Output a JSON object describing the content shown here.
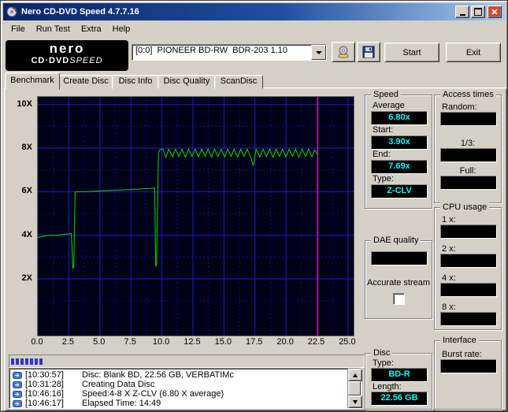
{
  "window": {
    "title": "Nero CD-DVD Speed 4.7.7.16"
  },
  "menu": {
    "items": [
      {
        "label": "File"
      },
      {
        "label": "Run Test"
      },
      {
        "label": "Extra"
      },
      {
        "label": "Help"
      }
    ]
  },
  "toolbar": {
    "logo": {
      "brand": "nero",
      "product_left": "CD·DVD",
      "product_right": "SPEED"
    },
    "drive_select": {
      "value": "[0:0]  PIONEER BD-RW  BDR-203 1.10"
    },
    "start_label": "Start",
    "exit_label": "Exit"
  },
  "tabs": {
    "items": [
      {
        "label": "Benchmark"
      },
      {
        "label": "Create Disc"
      },
      {
        "label": "Disc Info"
      },
      {
        "label": "Disc Quality"
      },
      {
        "label": "ScanDisc"
      }
    ],
    "active_index": 0
  },
  "chart_data": {
    "type": "line",
    "title": "",
    "xlabel": "",
    "ylabel": "",
    "x_ticks": [
      0,
      2.5,
      5,
      7.5,
      10,
      12.5,
      15,
      17.5,
      20,
      22.5,
      25
    ],
    "x_tick_labels": [
      "0.0",
      "2.5",
      "5.0",
      "7.5",
      "10.0",
      "12.5",
      "15.0",
      "17.5",
      "20.0",
      "22.5",
      "25.0"
    ],
    "y_ticks": [
      2,
      4,
      6,
      8,
      10
    ],
    "y_tick_labels": [
      "2X",
      "4X",
      "6X",
      "8X",
      "10X"
    ],
    "y_minor_ticks": [
      1,
      3,
      5,
      7,
      9
    ],
    "x_minor_step": 1.25,
    "xlim": [
      0,
      25.45
    ],
    "ylim": [
      -0.6,
      10.35
    ],
    "grid": true,
    "legend_position": "none",
    "marker_x": 22.56,
    "colors": {
      "background": "#000018",
      "grid_major": "#1c1cd0",
      "grid_minor": "#10108c",
      "marker": "#e8007c"
    },
    "series": [
      {
        "name": "write-speed",
        "color": "#00e000",
        "points": [
          [
            0,
            3.9
          ],
          [
            0.4,
            3.95
          ],
          [
            0.9,
            4.0
          ],
          [
            1.6,
            4.0
          ],
          [
            2.2,
            4.05
          ],
          [
            2.7,
            4.08
          ],
          [
            2.78,
            3.2
          ],
          [
            2.82,
            2.5
          ],
          [
            2.9,
            2.55
          ],
          [
            3.0,
            5.9
          ],
          [
            3.05,
            6.0
          ],
          [
            3.8,
            6.0
          ],
          [
            4.6,
            6.02
          ],
          [
            5.5,
            6.05
          ],
          [
            6.4,
            6.07
          ],
          [
            7.3,
            6.1
          ],
          [
            8.2,
            6.12
          ],
          [
            9.0,
            6.15
          ],
          [
            9.42,
            6.17
          ],
          [
            9.5,
            2.6
          ],
          [
            9.58,
            2.65
          ],
          [
            9.72,
            7.8
          ],
          [
            9.85,
            7.93
          ],
          [
            10.1,
            7.95
          ],
          [
            10.32,
            7.58
          ],
          [
            10.55,
            7.95
          ],
          [
            10.85,
            7.6
          ],
          [
            11.1,
            7.95
          ],
          [
            11.38,
            7.62
          ],
          [
            11.62,
            7.95
          ],
          [
            11.9,
            7.58
          ],
          [
            12.15,
            7.95
          ],
          [
            12.42,
            7.62
          ],
          [
            12.68,
            7.95
          ],
          [
            12.95,
            7.6
          ],
          [
            13.2,
            7.95
          ],
          [
            13.48,
            7.62
          ],
          [
            13.72,
            7.95
          ],
          [
            14.0,
            7.58
          ],
          [
            14.25,
            7.95
          ],
          [
            14.52,
            7.62
          ],
          [
            14.78,
            7.95
          ],
          [
            15.05,
            7.6
          ],
          [
            15.3,
            7.95
          ],
          [
            15.58,
            7.62
          ],
          [
            15.82,
            7.95
          ],
          [
            16.1,
            7.58
          ],
          [
            16.35,
            7.95
          ],
          [
            16.62,
            7.62
          ],
          [
            16.88,
            7.95
          ],
          [
            17.15,
            7.6
          ],
          [
            17.35,
            7.2
          ],
          [
            17.45,
            7.45
          ],
          [
            17.6,
            7.95
          ],
          [
            17.9,
            7.6
          ],
          [
            18.15,
            7.95
          ],
          [
            18.42,
            7.62
          ],
          [
            18.68,
            7.95
          ],
          [
            18.95,
            7.58
          ],
          [
            19.2,
            7.95
          ],
          [
            19.48,
            7.62
          ],
          [
            19.72,
            7.95
          ],
          [
            20.0,
            7.6
          ],
          [
            20.25,
            7.95
          ],
          [
            20.52,
            7.62
          ],
          [
            20.78,
            7.95
          ],
          [
            21.05,
            7.58
          ],
          [
            21.3,
            7.95
          ],
          [
            21.58,
            7.62
          ],
          [
            21.82,
            7.95
          ],
          [
            22.1,
            7.6
          ],
          [
            22.3,
            7.92
          ],
          [
            22.56,
            7.69
          ]
        ]
      }
    ]
  },
  "panels": {
    "speed": {
      "title": "Speed",
      "average_label": "Average",
      "average_value": "6.80x",
      "start_label": "Start:",
      "start_value": "3.90x",
      "end_label": "End:",
      "end_value": "7.69x",
      "type_label": "Type:",
      "type_value": "Z-CLV"
    },
    "access_times": {
      "title": "Access times",
      "random_label": "Random:",
      "random_value": "",
      "third_label": "1/3:",
      "third_value": "",
      "full_label": "Full:",
      "full_value": ""
    },
    "cpu_usage": {
      "title": "CPU usage",
      "items": [
        {
          "label": "1 x:",
          "value": ""
        },
        {
          "label": "2 x:",
          "value": ""
        },
        {
          "label": "4 x:",
          "value": ""
        },
        {
          "label": "8 x:",
          "value": ""
        }
      ]
    },
    "dae_quality": {
      "title": "DAE quality",
      "value": "",
      "accurate_stream_label": "Accurate stream",
      "accurate_stream_checked": false
    },
    "disc": {
      "title": "Disc",
      "type_label": "Type:",
      "type_value": "BD-R",
      "length_label": "Length:",
      "length_value": "22.56 GB"
    },
    "interface": {
      "title": "Interface",
      "burst_label": "Burst rate:",
      "burst_value": ""
    }
  },
  "progress": {
    "percent": 10
  },
  "log": {
    "lines": [
      {
        "time": "[10:30:57]",
        "text": "Disc: Blank BD, 22.56 GB, VERBATIMc"
      },
      {
        "time": "[10:31:28]",
        "text": "Creating Data Disc"
      },
      {
        "time": "[10:46:16]",
        "text": "Speed:4-8 X Z-CLV (6.80 X average)"
      },
      {
        "time": "[10:46:17]",
        "text": "Elapsed Time: 14:49"
      }
    ]
  }
}
